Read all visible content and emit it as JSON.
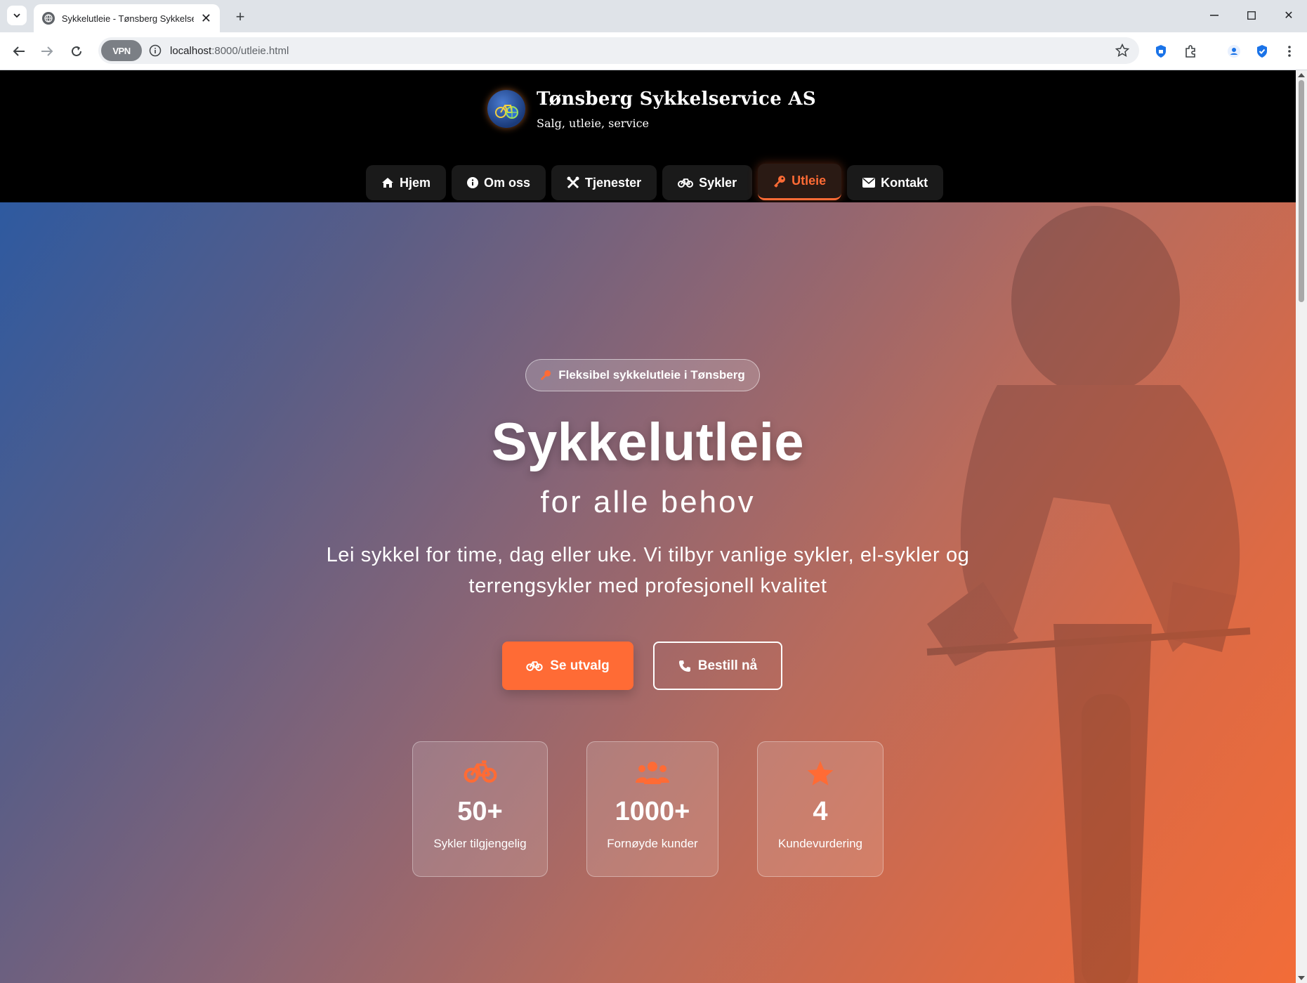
{
  "browser": {
    "tab_title": "Sykkelutleie - Tønsberg Sykkelservice AS",
    "url_host": "localhost",
    "url_rest": ":8000/utleie.html",
    "vpn_label": "VPN"
  },
  "site": {
    "title": "Tønsberg Sykkelservice AS",
    "subtitle": "Salg, utleie, service"
  },
  "menu": [
    {
      "label": "Hjem",
      "icon": "home-icon",
      "active": false
    },
    {
      "label": "Om oss",
      "icon": "info-icon",
      "active": false
    },
    {
      "label": "Tjenester",
      "icon": "tools-icon",
      "active": false
    },
    {
      "label": "Sykler",
      "icon": "bicycle-icon",
      "active": false
    },
    {
      "label": "Utleie",
      "icon": "key-icon",
      "active": true
    },
    {
      "label": "Kontakt",
      "icon": "envelope-icon",
      "active": false
    }
  ],
  "hero": {
    "badge": "Fleksibel sykkelutleie i Tønsberg",
    "title": "Sykkelutleie",
    "subtitle": "for alle behov",
    "description": "Lei sykkel for time, dag eller uke. Vi tilbyr vanlige sykler, el-sykler og terrengsykler med profesjonell kvalitet",
    "primary_button": "Se utvalg",
    "secondary_button": "Bestill nå"
  },
  "stats": [
    {
      "value": "50+",
      "label": "Sykler tilgjengelig",
      "icon": "bicycle-icon"
    },
    {
      "value": "1000+",
      "label": "Fornøyde kunder",
      "icon": "users-icon"
    },
    {
      "value": "4",
      "label": "Kundevurdering",
      "icon": "star-icon"
    }
  ],
  "colors": {
    "accent": "#ff6b35",
    "header_bg": "#000000"
  }
}
